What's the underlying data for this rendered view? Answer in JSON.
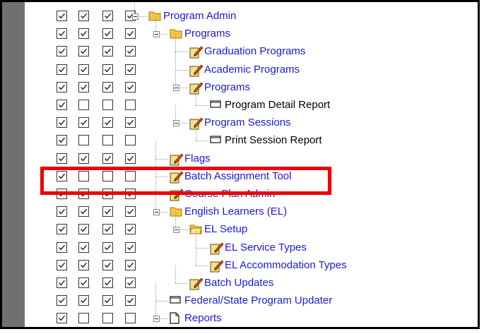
{
  "tree": {
    "items": [
      {
        "label": "Program Admin",
        "level": 0,
        "icon": "folder-icon",
        "expander": true,
        "link": true,
        "checks": [
          true,
          true,
          true,
          true
        ]
      },
      {
        "label": "Programs",
        "level": 1,
        "icon": "folder-icon",
        "expander": true,
        "link": true,
        "checks": [
          true,
          true,
          true,
          true
        ]
      },
      {
        "label": "Graduation Programs",
        "level": 2,
        "icon": "tool-icon",
        "expander": false,
        "link": true,
        "checks": [
          true,
          true,
          true,
          true
        ]
      },
      {
        "label": "Academic Programs",
        "level": 2,
        "icon": "tool-icon",
        "expander": false,
        "link": true,
        "checks": [
          true,
          true,
          true,
          true
        ]
      },
      {
        "label": "Programs",
        "level": 2,
        "icon": "tool-icon",
        "expander": true,
        "link": true,
        "checks": [
          true,
          true,
          true,
          true
        ]
      },
      {
        "label": "Program Detail Report",
        "level": 3,
        "icon": "report-icon",
        "expander": false,
        "link": false,
        "checks": [
          true,
          false,
          false,
          false
        ]
      },
      {
        "label": "Program Sessions",
        "level": 2,
        "icon": "tool-icon",
        "expander": true,
        "link": true,
        "checks": [
          true,
          true,
          true,
          true
        ]
      },
      {
        "label": "Print Session Report",
        "level": 3,
        "icon": "report-icon",
        "expander": false,
        "link": false,
        "checks": [
          true,
          false,
          false,
          false
        ]
      },
      {
        "label": "Flags",
        "level": 1,
        "icon": "tool-icon",
        "expander": false,
        "link": true,
        "checks": [
          true,
          true,
          true,
          true
        ]
      },
      {
        "label": "Batch Assignment Tool",
        "level": 1,
        "icon": "tool-icon",
        "expander": false,
        "link": true,
        "checks": [
          true,
          false,
          false,
          false
        ]
      },
      {
        "label": "Course Plan Admin",
        "level": 1,
        "icon": "tool-icon",
        "expander": false,
        "link": true,
        "checks": [
          true,
          true,
          true,
          true
        ]
      },
      {
        "label": "English Learners (EL)",
        "level": 1,
        "icon": "folder-icon",
        "expander": true,
        "link": true,
        "checks": [
          true,
          true,
          true,
          true
        ]
      },
      {
        "label": "EL Setup",
        "level": 2,
        "icon": "folder-open-icon",
        "expander": true,
        "link": true,
        "checks": [
          true,
          true,
          true,
          true
        ]
      },
      {
        "label": "EL Service Types",
        "level": 3,
        "icon": "tool-icon",
        "expander": false,
        "link": true,
        "checks": [
          true,
          true,
          true,
          true
        ]
      },
      {
        "label": "EL Accommodation Types",
        "level": 3,
        "icon": "tool-icon",
        "expander": false,
        "link": true,
        "checks": [
          true,
          true,
          true,
          true
        ]
      },
      {
        "label": "Batch Updates",
        "level": 2,
        "icon": "tool-icon",
        "expander": false,
        "link": true,
        "checks": [
          true,
          true,
          true,
          true
        ]
      },
      {
        "label": "Federal/State Program Updater",
        "level": 1,
        "icon": "report-icon",
        "expander": false,
        "link": true,
        "checks": [
          true,
          true,
          true,
          true
        ]
      },
      {
        "label": "Reports",
        "level": 1,
        "icon": "page-icon",
        "expander": true,
        "link": true,
        "checks": [
          true,
          false,
          false,
          false
        ]
      }
    ]
  },
  "highlight_color": "#ee0000",
  "link_color": "#1a1ad6",
  "folder_color": "#f5c542"
}
